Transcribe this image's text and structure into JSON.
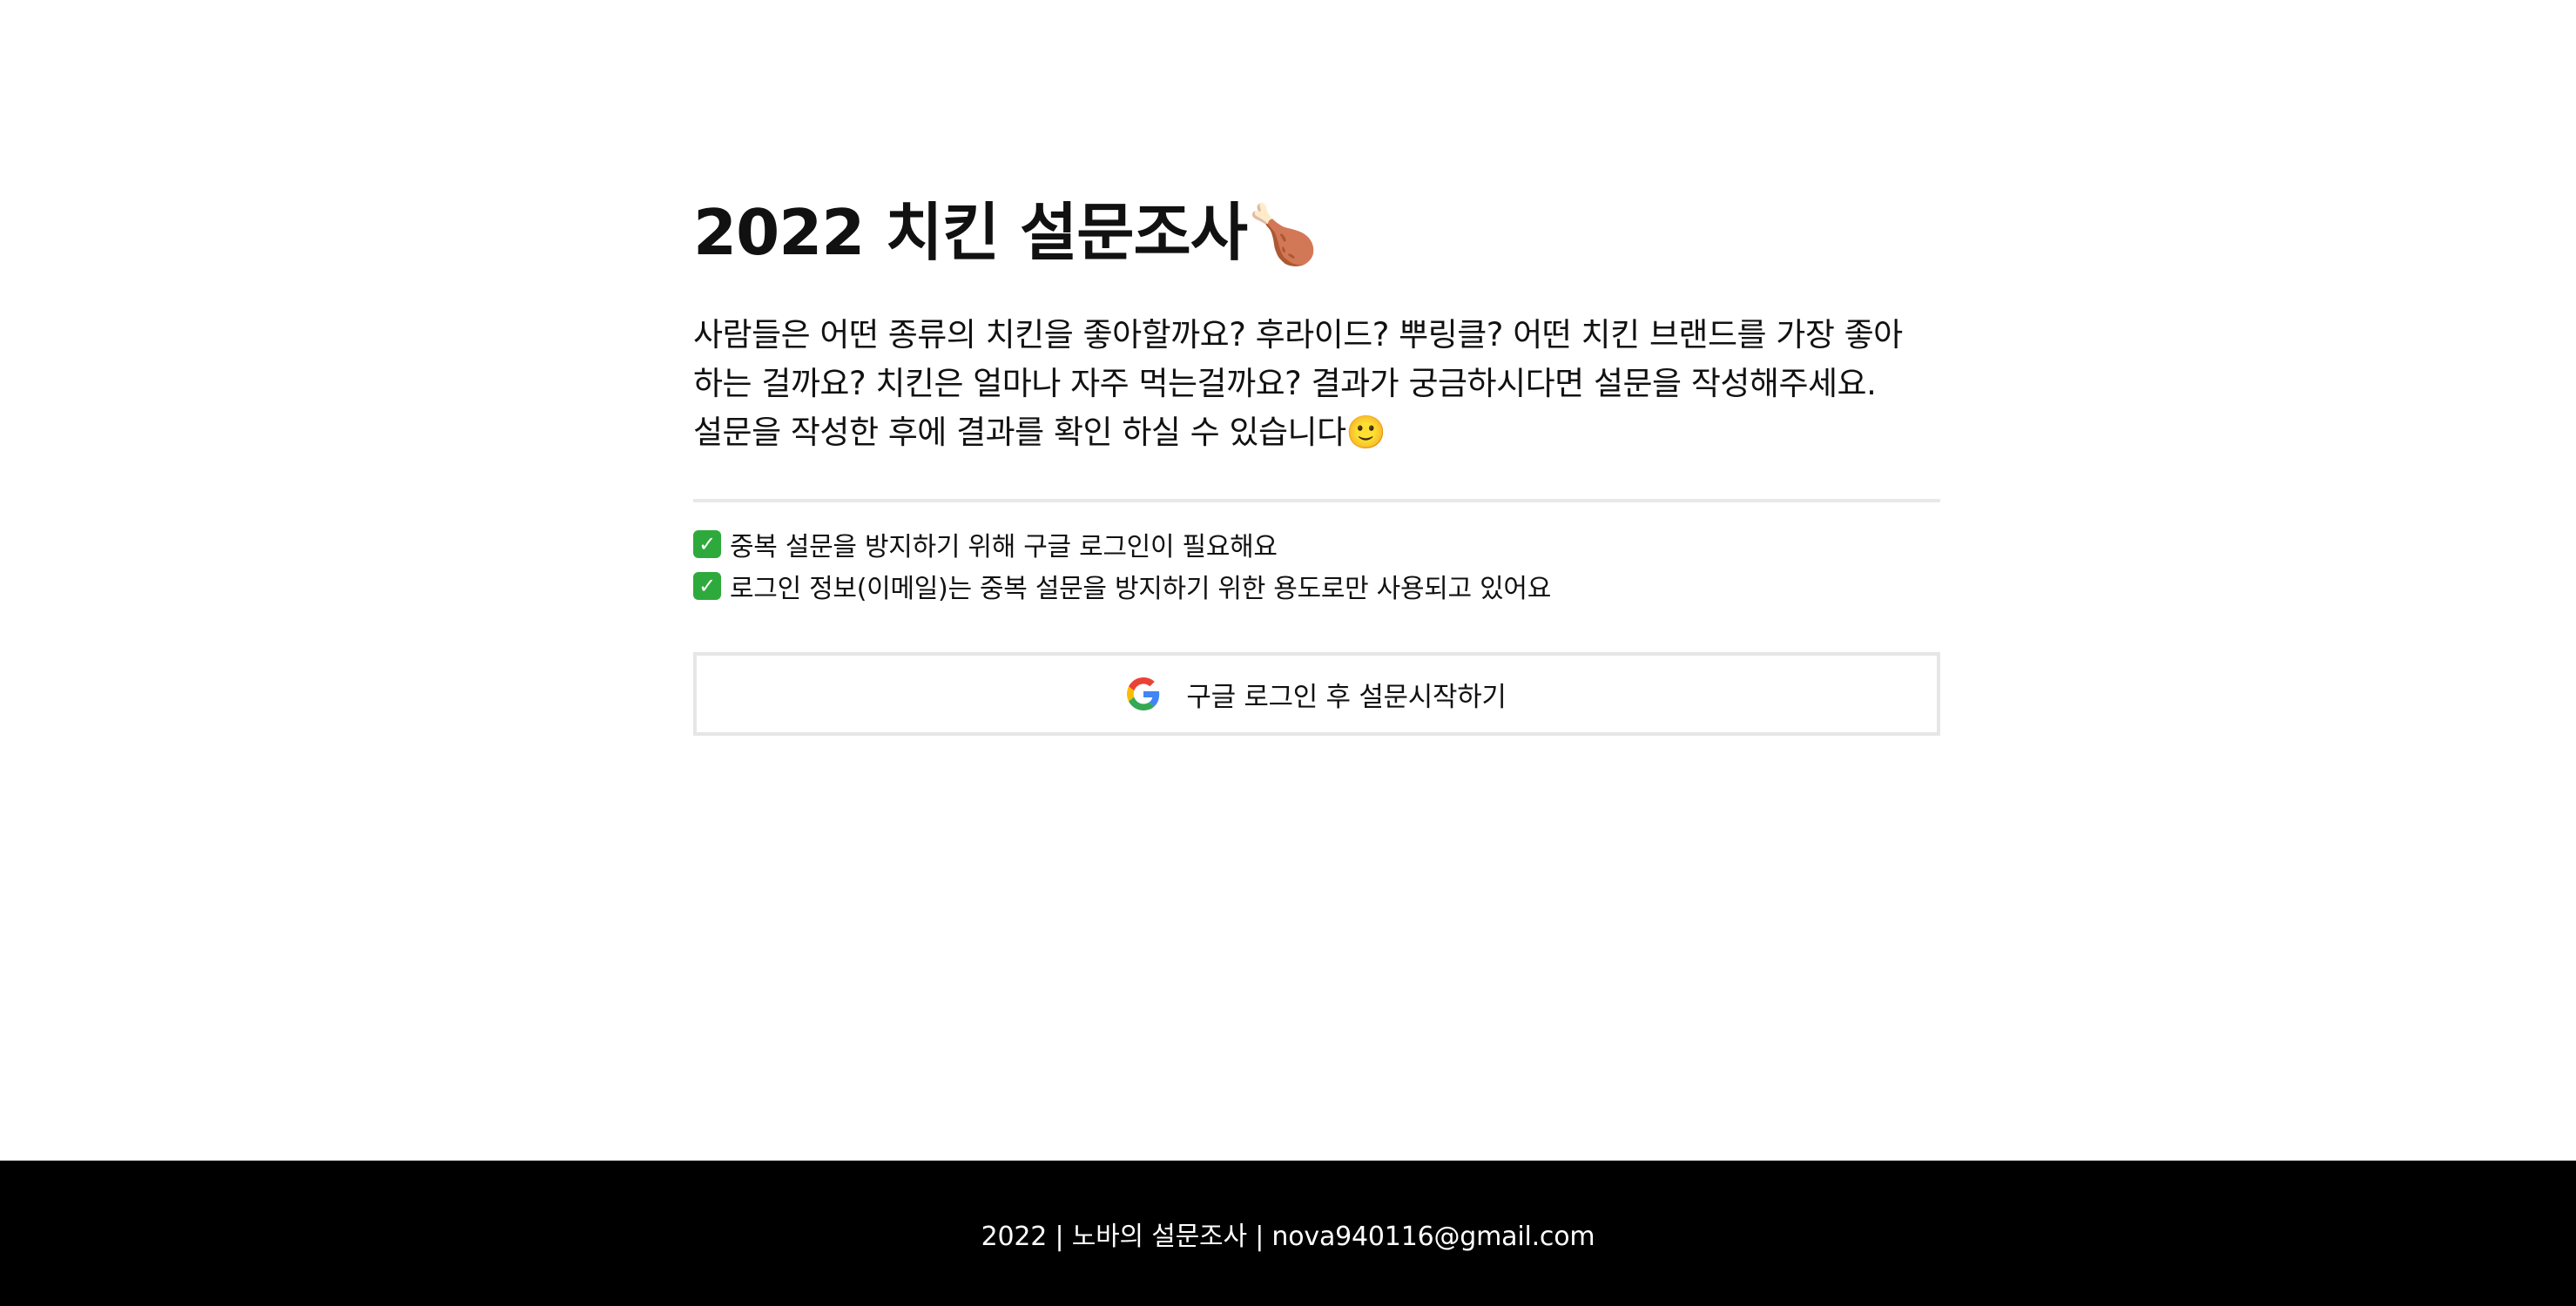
{
  "header": {
    "title": "2022 치킨 설문조사",
    "title_emoji": "🍗"
  },
  "intro": {
    "line1": "사람들은 어떤 종류의 치킨을 좋아할까요? 후라이드? 뿌링클? 어떤 치킨 브랜드를 가장 좋아",
    "line2": "하는 걸까요? 치킨은 얼마나 자주 먹는걸까요? 결과가 궁금하시다면 설문을 작성해주세요.",
    "line3": "설문을 작성한 후에 결과를 확인 하실 수 있습니다",
    "emoji": "🙂"
  },
  "notices": [
    {
      "icon": "check-mark-icon",
      "text": "중복 설문을 방지하기 위해 구글 로그인이 필요해요"
    },
    {
      "icon": "check-mark-icon",
      "text": "로그인 정보(이메일)는 중복 설문을 방지하기 위한 용도로만 사용되고 있어요"
    }
  ],
  "login_button": {
    "icon": "google-icon",
    "label": "구글 로그인 후 설문시작하기"
  },
  "footer": {
    "text": "2022 | 노바의 설문조사 | nova940116@gmail.com"
  },
  "colors": {
    "background": "#ffffff",
    "text": "#111111",
    "divider": "#e8e8e8",
    "button_border": "#e6e6e6",
    "check_green": "#2eaa3c",
    "footer_bg": "#000000",
    "footer_text": "#ffffff"
  }
}
